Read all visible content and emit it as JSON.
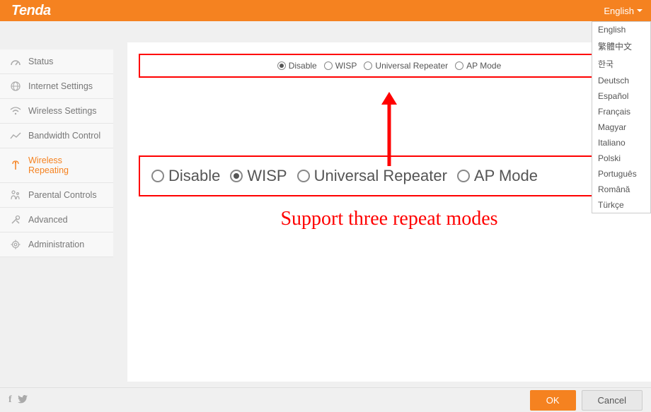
{
  "header": {
    "logo": "Tenda",
    "current_language": "English",
    "languages": [
      "English",
      "繁體中文",
      "한국",
      "Deutsch",
      "Español",
      "Français",
      "Magyar",
      "Italiano",
      "Polski",
      "Português",
      "Română",
      "Türkçe"
    ]
  },
  "sidebar": {
    "items": [
      {
        "label": "Status",
        "icon": "gauge-icon"
      },
      {
        "label": "Internet Settings",
        "icon": "globe-icon"
      },
      {
        "label": "Wireless Settings",
        "icon": "wifi-icon"
      },
      {
        "label": "Bandwidth Control",
        "icon": "chart-icon"
      },
      {
        "label": "Wireless Repeating",
        "icon": "antenna-icon",
        "active": true
      },
      {
        "label": "Parental Controls",
        "icon": "family-icon"
      },
      {
        "label": "Advanced",
        "icon": "tools-icon"
      },
      {
        "label": "Administration",
        "icon": "gear-icon"
      }
    ]
  },
  "modes": {
    "small": {
      "options": [
        "Disable",
        "WISP",
        "Universal Repeater",
        "AP Mode"
      ],
      "selected": 0
    },
    "large": {
      "options": [
        "Disable",
        "WISP",
        "Universal Repeater",
        "AP Mode"
      ],
      "selected": 1
    }
  },
  "annotation": {
    "caption": "Support three repeat modes"
  },
  "footer": {
    "ok": "OK",
    "cancel": "Cancel"
  }
}
